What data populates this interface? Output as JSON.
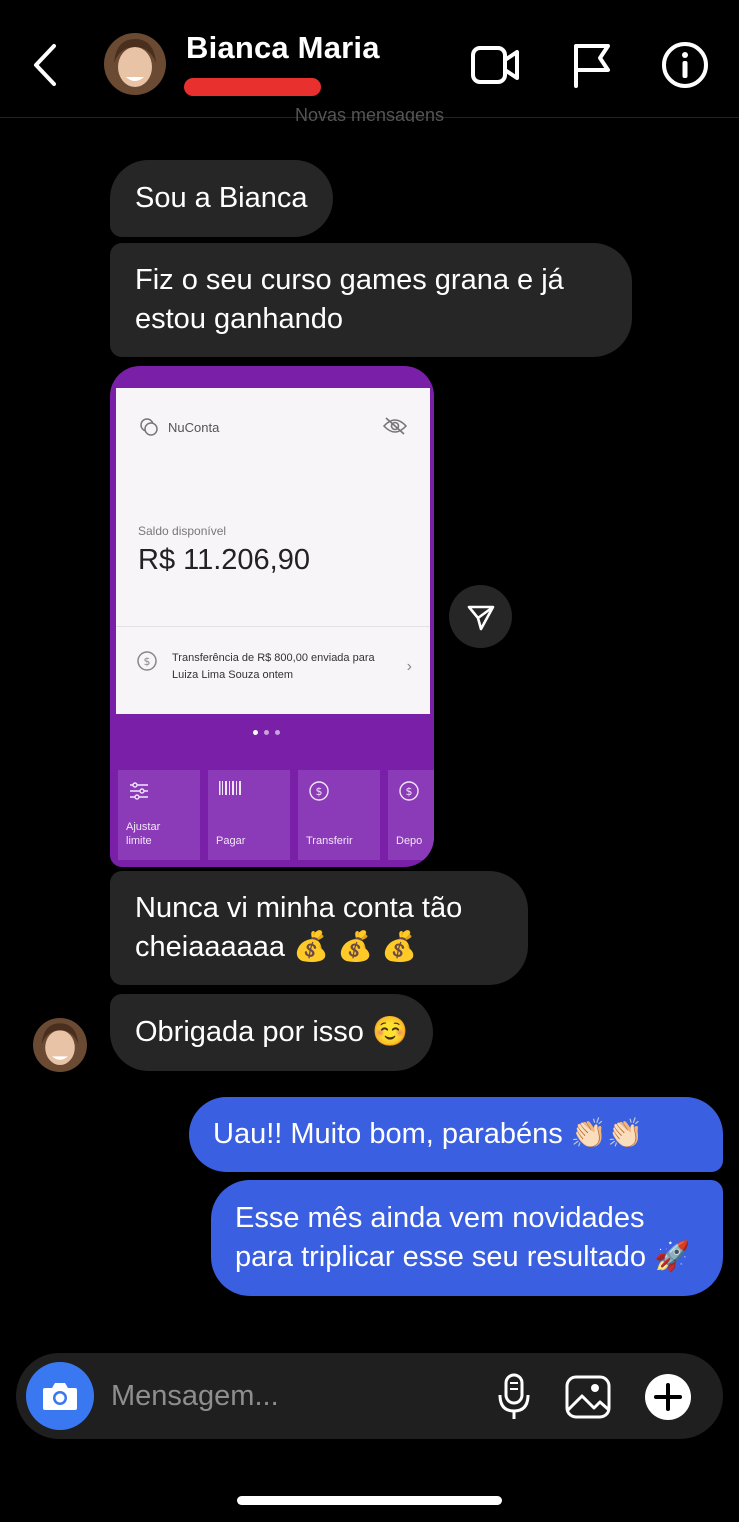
{
  "header": {
    "contact_name": "Bianca Maria",
    "new_messages_divider": "Novas mensagens"
  },
  "messages": [
    {
      "from": "contact",
      "text": "Sou a Bianca"
    },
    {
      "from": "contact",
      "text": "Fiz o seu curso games grana e já estou ganhando"
    },
    {
      "from": "contact",
      "text": "Nunca vi minha conta tão cheiaaaaaa 💰 💰 💰"
    },
    {
      "from": "contact",
      "text": "Obrigada por isso ☺️"
    },
    {
      "from": "me",
      "text": "Uau!! Muito bom, parabéns 👏🏻👏🏻"
    },
    {
      "from": "me",
      "text": "Esse mês ainda vem novidades para triplicar esse seu resultado 🚀"
    }
  ],
  "shared_image": {
    "account_label": "NuConta",
    "balance_label": "Saldo disponível",
    "balance_value": "R$ 11.206,90",
    "transfer_text": "Transferência de R$ 800,00 enviada para Luiza Lima Souza ontem",
    "tiles": [
      "Ajustar limite",
      "Pagar",
      "Transferir",
      "Depo"
    ]
  },
  "composer": {
    "placeholder": "Mensagem..."
  },
  "colors": {
    "outgoing_bubble": "#3a5fe0",
    "incoming_bubble": "#262626",
    "camera_button": "#3a78f2",
    "nubank_purple": "#7a1fa8",
    "redaction": "#e8302e"
  },
  "icons": {
    "back": "chevron-left-icon",
    "video": "video-camera-icon",
    "flag": "flag-icon",
    "info": "info-icon",
    "share": "paper-plane-icon",
    "camera": "camera-icon",
    "mic": "microphone-icon",
    "gallery": "gallery-icon",
    "plus": "plus-icon"
  }
}
